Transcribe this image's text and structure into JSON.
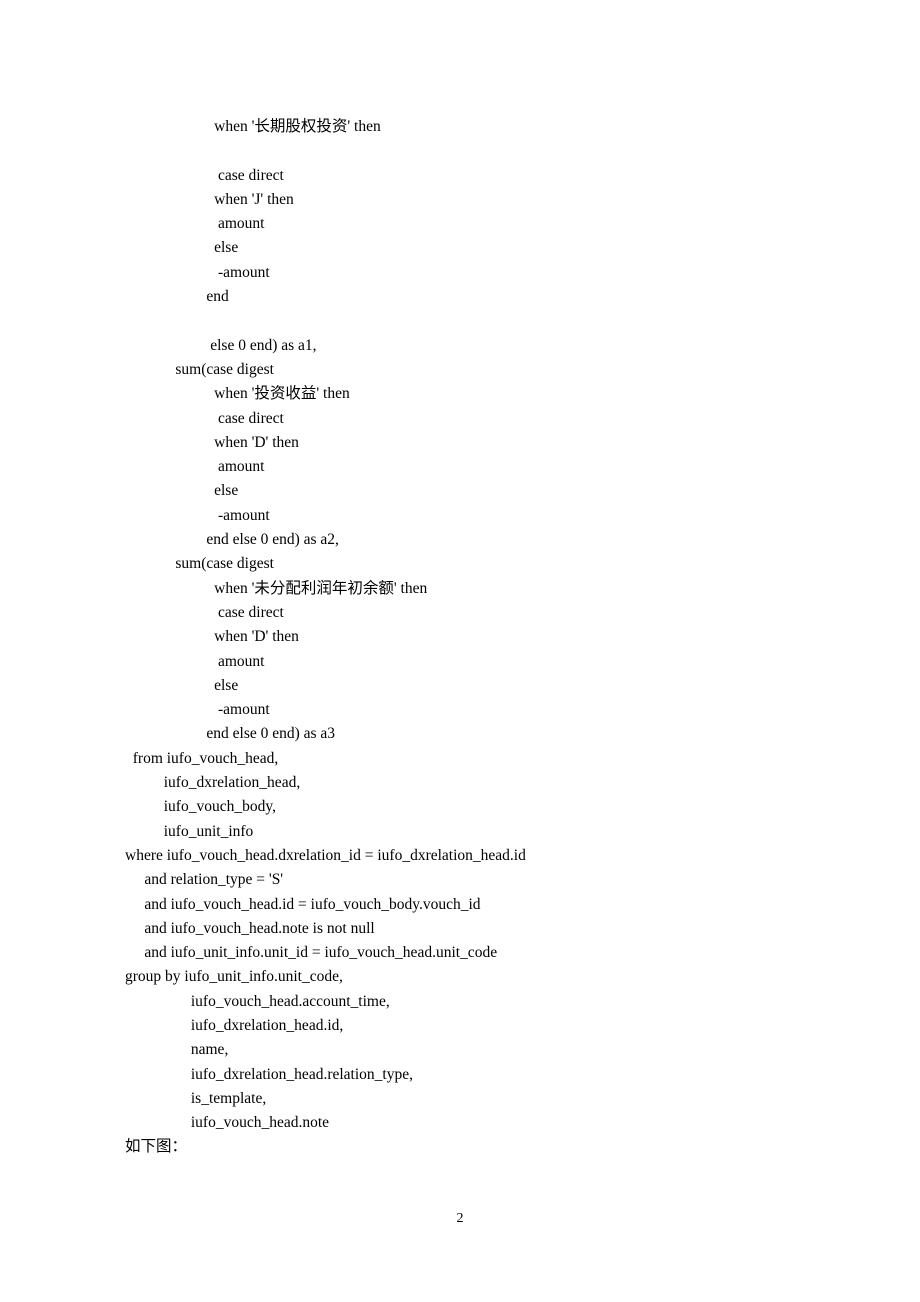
{
  "lines": [
    "                       when '长期股权投资' then",
    "",
    "                        case direct",
    "                       when 'J' then",
    "                        amount",
    "                       else",
    "                        -amount",
    "                     end",
    "",
    "                      else 0 end) as a1,",
    "             sum(case digest",
    "                       when '投资收益' then",
    "                        case direct",
    "                       when 'D' then",
    "                        amount",
    "                       else",
    "                        -amount",
    "                     end else 0 end) as a2,",
    "             sum(case digest",
    "                       when '未分配利润年初余额' then",
    "                        case direct",
    "                       when 'D' then",
    "                        amount",
    "                       else",
    "                        -amount",
    "                     end else 0 end) as a3",
    "  from iufo_vouch_head,",
    "          iufo_dxrelation_head,",
    "          iufo_vouch_body,",
    "          iufo_unit_info",
    "where iufo_vouch_head.dxrelation_id = iufo_dxrelation_head.id",
    "     and relation_type = 'S'",
    "     and iufo_vouch_head.id = iufo_vouch_body.vouch_id",
    "     and iufo_vouch_head.note is not null",
    "     and iufo_unit_info.unit_id = iufo_vouch_head.unit_code",
    "group by iufo_unit_info.unit_code,",
    "                 iufo_vouch_head.account_time,",
    "                 iufo_dxrelation_head.id,",
    "                 name,",
    "                 iufo_dxrelation_head.relation_type,",
    "                 is_template,",
    "                 iufo_vouch_head.note",
    "如下图："
  ],
  "pageNumber": "2"
}
